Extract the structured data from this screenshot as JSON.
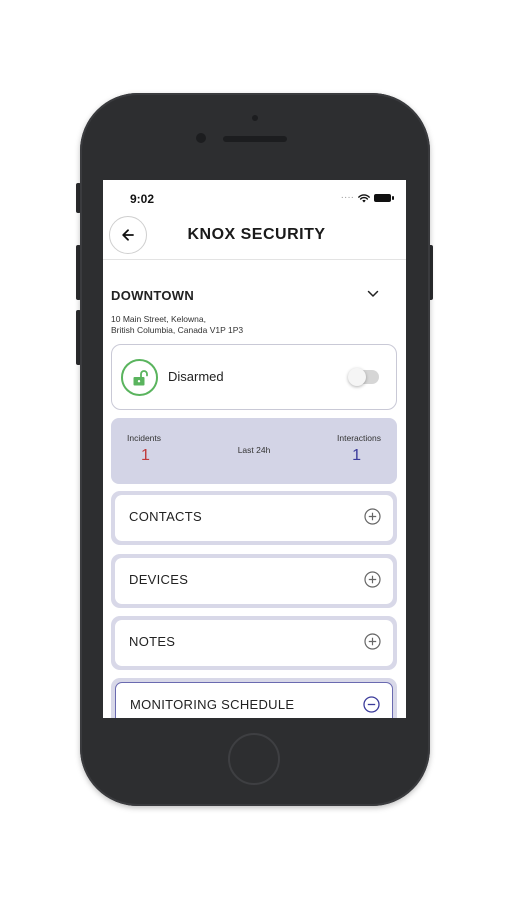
{
  "status_bar": {
    "time": "9:02"
  },
  "header": {
    "title": "KNOX SECURITY"
  },
  "location": {
    "name": "DOWNTOWN",
    "address_line1": "10 Main Street, Kelowna,",
    "address_line2": "British Columbia, Canada V1P 1P3"
  },
  "arm_status": {
    "label": "Disarmed",
    "armed": false
  },
  "stats": {
    "incidents_label": "Incidents",
    "incidents_value": "1",
    "period_label": "Last 24h",
    "interactions_label": "Interactions",
    "interactions_value": "1"
  },
  "sections": [
    {
      "label": "CONTACTS",
      "icon": "plus-circle-icon",
      "expanded": false
    },
    {
      "label": "DEVICES",
      "icon": "plus-circle-icon",
      "expanded": false
    },
    {
      "label": "NOTES",
      "icon": "plus-circle-icon",
      "expanded": false
    },
    {
      "label": "MONITORING SCHEDULE",
      "icon": "minus-circle-icon",
      "expanded": true
    }
  ],
  "colors": {
    "accent": "#3a3a9a",
    "incident": "#c0393b",
    "unlocked": "#5ab45e",
    "stats_bg": "#d3d4e6"
  }
}
